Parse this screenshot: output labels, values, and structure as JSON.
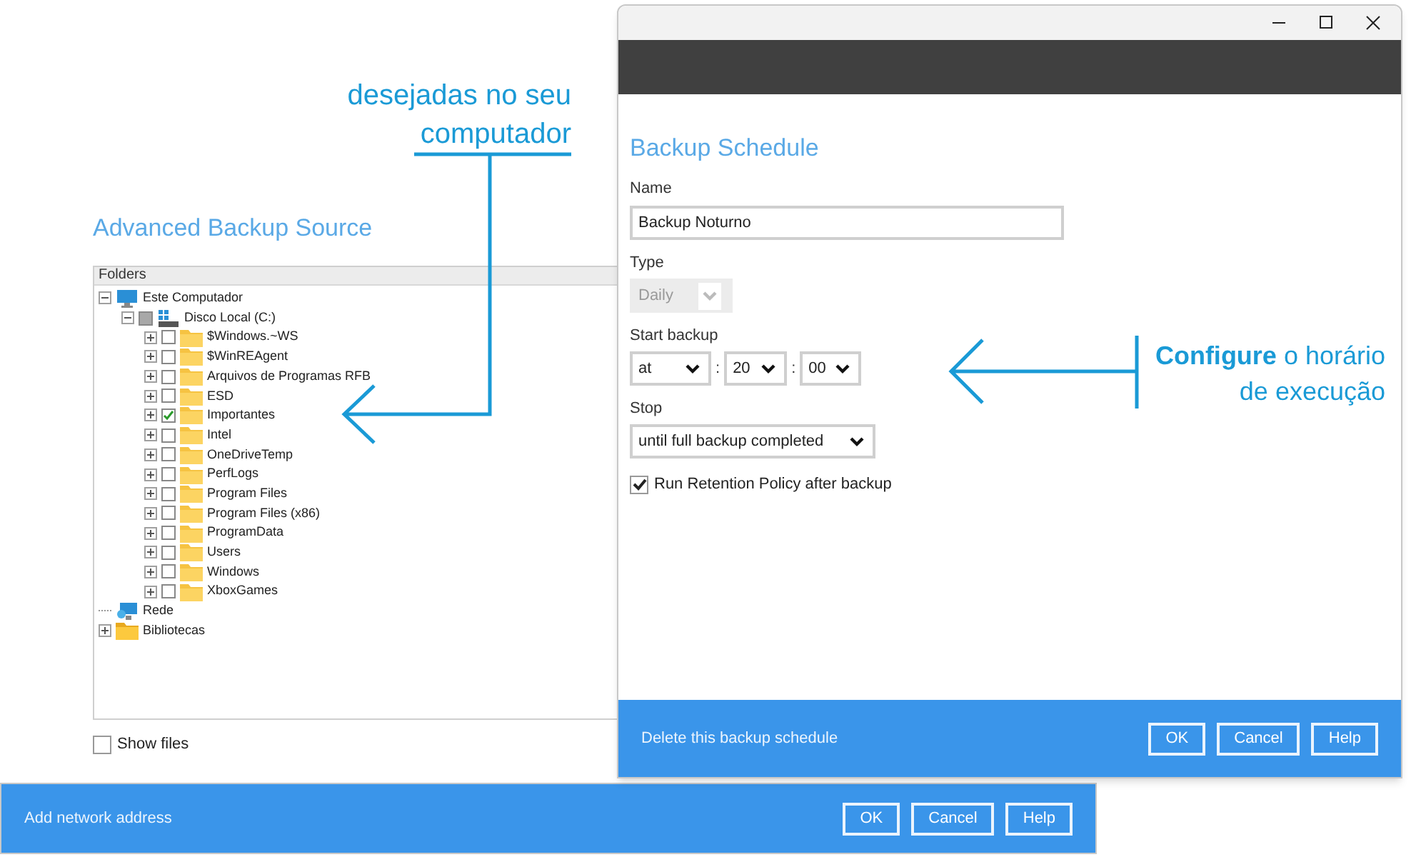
{
  "source_window": {
    "title": "Advanced Backup Source",
    "tree_header": "Folders",
    "tree": [
      {
        "label": "Este Computador",
        "kind": "computer",
        "expanded": true,
        "children": [
          {
            "label": "Disco Local (C:)",
            "kind": "drive",
            "expanded": true,
            "checked": false,
            "partial": true,
            "children": [
              {
                "label": "$Windows.~WS",
                "kind": "folder",
                "expanded": false,
                "checked": false,
                "partial": false
              },
              {
                "label": "$WinREAgent",
                "kind": "folder",
                "expanded": false,
                "checked": false,
                "partial": false
              },
              {
                "label": "Arquivos de Programas RFB",
                "kind": "folder",
                "expanded": false,
                "checked": false,
                "partial": false
              },
              {
                "label": "ESD",
                "kind": "folder",
                "expanded": false,
                "checked": false,
                "partial": false
              },
              {
                "label": "Importantes",
                "kind": "folder",
                "expanded": false,
                "checked": true,
                "partial": false
              },
              {
                "label": "Intel",
                "kind": "folder",
                "expanded": false,
                "checked": false,
                "partial": false
              },
              {
                "label": "OneDriveTemp",
                "kind": "folder",
                "expanded": false,
                "checked": false,
                "partial": false
              },
              {
                "label": "PerfLogs",
                "kind": "folder",
                "expanded": false,
                "checked": false,
                "partial": false
              },
              {
                "label": "Program Files",
                "kind": "folder",
                "expanded": false,
                "checked": false,
                "partial": false
              },
              {
                "label": "Program Files (x86)",
                "kind": "folder",
                "expanded": false,
                "checked": false,
                "partial": false
              },
              {
                "label": "ProgramData",
                "kind": "folder",
                "expanded": false,
                "checked": false,
                "partial": false
              },
              {
                "label": "Users",
                "kind": "folder",
                "expanded": false,
                "checked": false,
                "partial": false
              },
              {
                "label": "Windows",
                "kind": "folder",
                "expanded": false,
                "checked": false,
                "partial": false
              },
              {
                "label": "XboxGames",
                "kind": "folder",
                "expanded": false,
                "checked": false,
                "partial": false
              }
            ]
          }
        ]
      },
      {
        "label": "Rede",
        "kind": "network"
      },
      {
        "label": "Bibliotecas",
        "kind": "library",
        "expanded": false
      }
    ],
    "show_files": {
      "label": "Show files",
      "checked": false
    }
  },
  "network_bar": {
    "link": "Add network address",
    "buttons": [
      "OK",
      "Cancel",
      "Help"
    ]
  },
  "dialog": {
    "title": "Backup Schedule",
    "fields": [
      {
        "kind": "text",
        "label": "Name",
        "value": "Backup Noturno"
      },
      {
        "kind": "select",
        "label": "Type",
        "value": "Daily",
        "disabled": true
      },
      {
        "kind": "time",
        "label": "Start backup",
        "selects": [
          "at",
          "20",
          "00"
        ],
        "separator": ":"
      },
      {
        "kind": "select",
        "label": "Stop",
        "value": "until full backup completed",
        "disabled": false
      }
    ],
    "retention": {
      "label": "Run Retention Policy after backup",
      "checked": true
    },
    "footer": {
      "link": "Delete this backup schedule",
      "buttons": [
        "OK",
        "Cancel",
        "Help"
      ]
    }
  },
  "annotations": [
    {
      "lines": [
        "desejadas no seu",
        "computador"
      ]
    },
    {
      "lines": [
        "**Configure** o horário",
        "de execução"
      ]
    }
  ]
}
